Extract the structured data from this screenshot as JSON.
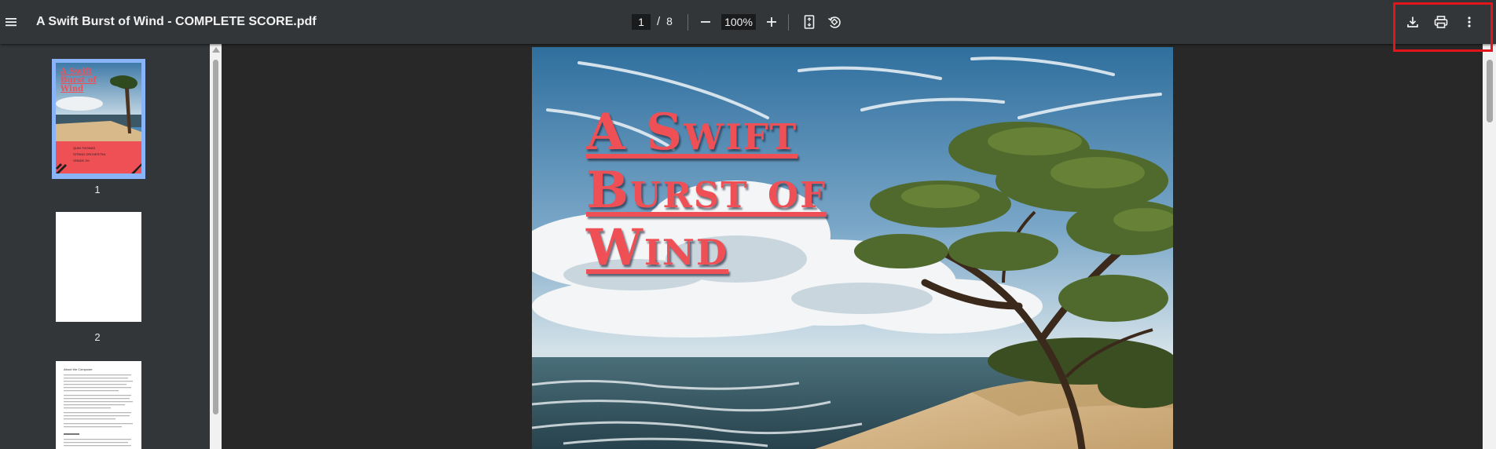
{
  "toolbar": {
    "title": "A Swift Burst of Wind - COMPLETE SCORE.pdf",
    "current_page": "1",
    "page_separator": "/",
    "total_pages": "8",
    "zoom": "100%"
  },
  "sidebar": {
    "thumbnails": [
      {
        "label": "1",
        "title_lines": [
          "A Swift",
          "Burst of",
          "Wind"
        ],
        "credits": [
          "QUIN THOMAS",
          "STRING ORCHESTRA",
          "GRADE 3½"
        ]
      },
      {
        "label": "2"
      },
      {
        "label": "3",
        "heading": "About the Composer"
      }
    ]
  },
  "cover": {
    "title_lines": [
      "A Swift",
      "Burst of",
      "Wind"
    ]
  },
  "colors": {
    "toolbar_bg": "#323639",
    "viewer_bg": "#282828",
    "title_red": "#ef5056",
    "selection_blue": "#8ab4f8",
    "highlight_red": "#e3151a"
  },
  "icons": [
    "menu-icon",
    "minus-icon",
    "plus-icon",
    "fit-page-icon",
    "rotate-icon",
    "download-icon",
    "print-icon",
    "more-vert-icon"
  ]
}
